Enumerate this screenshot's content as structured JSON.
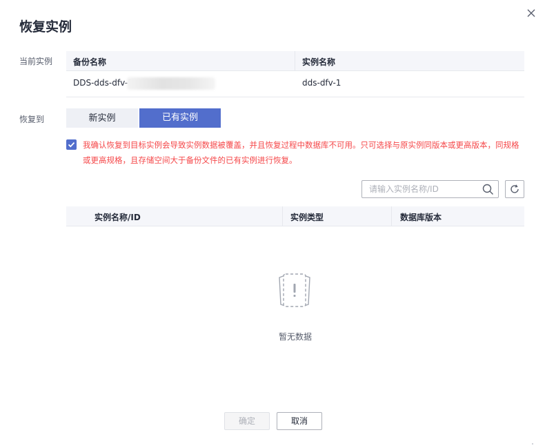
{
  "dialog": {
    "title": "恢复实例"
  },
  "current_instance": {
    "label": "当前实例",
    "columns": [
      "备份名称",
      "实例名称"
    ],
    "row": {
      "backup_name": "DDS-dds-dfv-1-",
      "instance_name": "dds-dfv-1"
    }
  },
  "restore_to": {
    "label": "恢复到",
    "options": [
      "新实例",
      "已有实例"
    ],
    "selected": "已有实例"
  },
  "confirm": {
    "checked": true,
    "text": "我确认恢复到目标实例会导致实例数据被覆盖，并且恢复过程中数据库不可用。只可选择与原实例同版本或更高版本，同规格或更高规格，且存储空间大于备份文件的已有实例进行恢复。"
  },
  "search": {
    "placeholder": "请输入实例名称/ID",
    "value": ""
  },
  "instance_table": {
    "columns": [
      "实例名称/ID",
      "实例类型",
      "数据库版本"
    ],
    "rows": [],
    "empty_text": "暂无数据"
  },
  "footer": {
    "ok_label": "确定",
    "cancel_label": "取消"
  },
  "colors": {
    "accent": "#526ecc",
    "warning": "#f5484a",
    "header_bg": "#f5f6fa"
  },
  "icons": [
    "close-icon",
    "check-icon",
    "search-icon",
    "refresh-icon",
    "empty-data-icon"
  ]
}
